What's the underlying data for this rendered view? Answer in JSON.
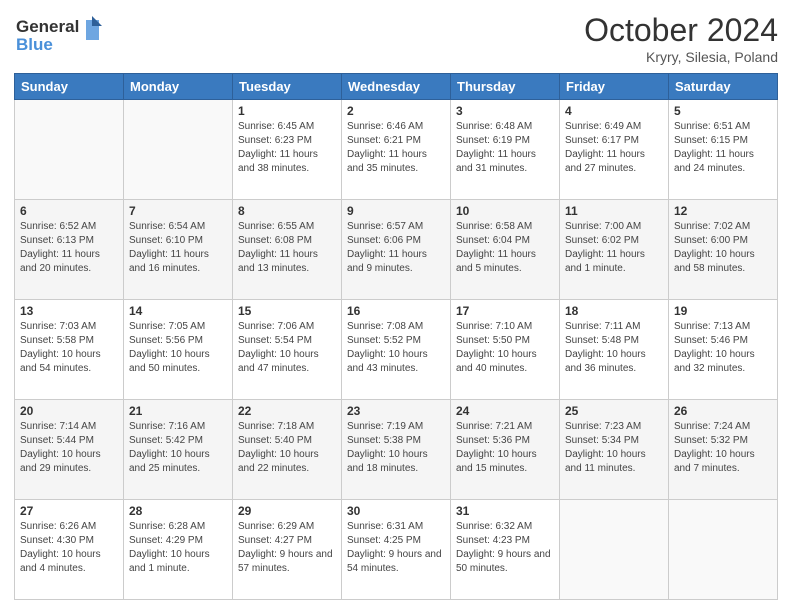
{
  "header": {
    "logo_line1": "General",
    "logo_line2": "Blue",
    "title": "October 2024",
    "subtitle": "Kryry, Silesia, Poland"
  },
  "days_of_week": [
    "Sunday",
    "Monday",
    "Tuesday",
    "Wednesday",
    "Thursday",
    "Friday",
    "Saturday"
  ],
  "weeks": [
    [
      {
        "day": "",
        "info": ""
      },
      {
        "day": "",
        "info": ""
      },
      {
        "day": "1",
        "info": "Sunrise: 6:45 AM\nSunset: 6:23 PM\nDaylight: 11 hours and 38 minutes."
      },
      {
        "day": "2",
        "info": "Sunrise: 6:46 AM\nSunset: 6:21 PM\nDaylight: 11 hours and 35 minutes."
      },
      {
        "day": "3",
        "info": "Sunrise: 6:48 AM\nSunset: 6:19 PM\nDaylight: 11 hours and 31 minutes."
      },
      {
        "day": "4",
        "info": "Sunrise: 6:49 AM\nSunset: 6:17 PM\nDaylight: 11 hours and 27 minutes."
      },
      {
        "day": "5",
        "info": "Sunrise: 6:51 AM\nSunset: 6:15 PM\nDaylight: 11 hours and 24 minutes."
      }
    ],
    [
      {
        "day": "6",
        "info": "Sunrise: 6:52 AM\nSunset: 6:13 PM\nDaylight: 11 hours and 20 minutes."
      },
      {
        "day": "7",
        "info": "Sunrise: 6:54 AM\nSunset: 6:10 PM\nDaylight: 11 hours and 16 minutes."
      },
      {
        "day": "8",
        "info": "Sunrise: 6:55 AM\nSunset: 6:08 PM\nDaylight: 11 hours and 13 minutes."
      },
      {
        "day": "9",
        "info": "Sunrise: 6:57 AM\nSunset: 6:06 PM\nDaylight: 11 hours and 9 minutes."
      },
      {
        "day": "10",
        "info": "Sunrise: 6:58 AM\nSunset: 6:04 PM\nDaylight: 11 hours and 5 minutes."
      },
      {
        "day": "11",
        "info": "Sunrise: 7:00 AM\nSunset: 6:02 PM\nDaylight: 11 hours and 1 minute."
      },
      {
        "day": "12",
        "info": "Sunrise: 7:02 AM\nSunset: 6:00 PM\nDaylight: 10 hours and 58 minutes."
      }
    ],
    [
      {
        "day": "13",
        "info": "Sunrise: 7:03 AM\nSunset: 5:58 PM\nDaylight: 10 hours and 54 minutes."
      },
      {
        "day": "14",
        "info": "Sunrise: 7:05 AM\nSunset: 5:56 PM\nDaylight: 10 hours and 50 minutes."
      },
      {
        "day": "15",
        "info": "Sunrise: 7:06 AM\nSunset: 5:54 PM\nDaylight: 10 hours and 47 minutes."
      },
      {
        "day": "16",
        "info": "Sunrise: 7:08 AM\nSunset: 5:52 PM\nDaylight: 10 hours and 43 minutes."
      },
      {
        "day": "17",
        "info": "Sunrise: 7:10 AM\nSunset: 5:50 PM\nDaylight: 10 hours and 40 minutes."
      },
      {
        "day": "18",
        "info": "Sunrise: 7:11 AM\nSunset: 5:48 PM\nDaylight: 10 hours and 36 minutes."
      },
      {
        "day": "19",
        "info": "Sunrise: 7:13 AM\nSunset: 5:46 PM\nDaylight: 10 hours and 32 minutes."
      }
    ],
    [
      {
        "day": "20",
        "info": "Sunrise: 7:14 AM\nSunset: 5:44 PM\nDaylight: 10 hours and 29 minutes."
      },
      {
        "day": "21",
        "info": "Sunrise: 7:16 AM\nSunset: 5:42 PM\nDaylight: 10 hours and 25 minutes."
      },
      {
        "day": "22",
        "info": "Sunrise: 7:18 AM\nSunset: 5:40 PM\nDaylight: 10 hours and 22 minutes."
      },
      {
        "day": "23",
        "info": "Sunrise: 7:19 AM\nSunset: 5:38 PM\nDaylight: 10 hours and 18 minutes."
      },
      {
        "day": "24",
        "info": "Sunrise: 7:21 AM\nSunset: 5:36 PM\nDaylight: 10 hours and 15 minutes."
      },
      {
        "day": "25",
        "info": "Sunrise: 7:23 AM\nSunset: 5:34 PM\nDaylight: 10 hours and 11 minutes."
      },
      {
        "day": "26",
        "info": "Sunrise: 7:24 AM\nSunset: 5:32 PM\nDaylight: 10 hours and 7 minutes."
      }
    ],
    [
      {
        "day": "27",
        "info": "Sunrise: 6:26 AM\nSunset: 4:30 PM\nDaylight: 10 hours and 4 minutes."
      },
      {
        "day": "28",
        "info": "Sunrise: 6:28 AM\nSunset: 4:29 PM\nDaylight: 10 hours and 1 minute."
      },
      {
        "day": "29",
        "info": "Sunrise: 6:29 AM\nSunset: 4:27 PM\nDaylight: 9 hours and 57 minutes."
      },
      {
        "day": "30",
        "info": "Sunrise: 6:31 AM\nSunset: 4:25 PM\nDaylight: 9 hours and 54 minutes."
      },
      {
        "day": "31",
        "info": "Sunrise: 6:32 AM\nSunset: 4:23 PM\nDaylight: 9 hours and 50 minutes."
      },
      {
        "day": "",
        "info": ""
      },
      {
        "day": "",
        "info": ""
      }
    ]
  ],
  "colors": {
    "header_bg": "#3a7abf",
    "accent": "#4a90d9"
  }
}
